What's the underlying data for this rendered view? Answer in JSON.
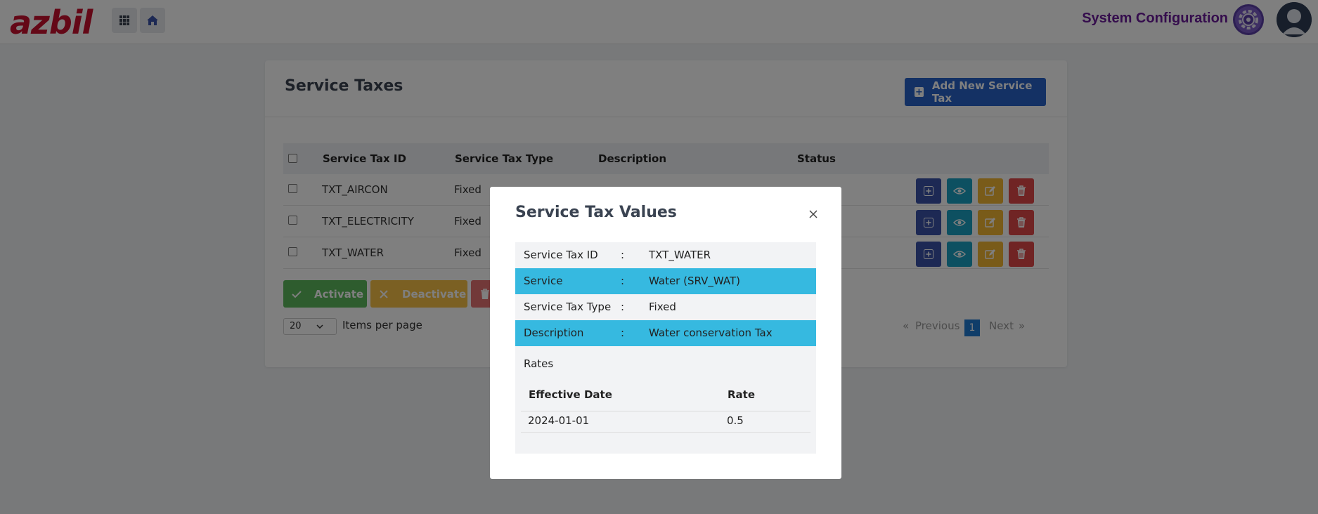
{
  "app": {
    "logo_text": "azbil",
    "section_title": "System Configuration",
    "icons": [
      "apps-grid-icon",
      "home-icon",
      "gear-icon",
      "user-avatar-icon"
    ]
  },
  "page": {
    "title": "Service Taxes",
    "add_button_label": "Add New Service Tax",
    "table": {
      "headers": [
        "Service Tax ID",
        "Service Tax Type",
        "Description",
        "Status"
      ],
      "rows": [
        {
          "id": "TXT_AIRCON",
          "type": "Fixed"
        },
        {
          "id": "TXT_ELECTRICITY",
          "type": "Fixed"
        },
        {
          "id": "TXT_WATER",
          "type": "Fixed"
        }
      ]
    },
    "bulk_actions": {
      "activate": "Activate",
      "deactivate": "Deactivate"
    },
    "pagination": {
      "per_page_value": "20",
      "per_page_label": "Items per page",
      "previous": "Previous",
      "current": "1",
      "next": "Next",
      "prev_glyph": "«",
      "next_glyph": "»"
    }
  },
  "modal": {
    "title": "Service Tax Values",
    "separator": ":",
    "fields": [
      {
        "label": "Service Tax ID",
        "value": "TXT_WATER"
      },
      {
        "label": "Service",
        "value": "Water (SRV_WAT)"
      },
      {
        "label": "Service Tax Type",
        "value": "Fixed"
      },
      {
        "label": "Description",
        "value": "Water conservation Tax"
      }
    ],
    "rates": {
      "label": "Rates",
      "headers": [
        "Effective Date",
        "Rate"
      ],
      "rows": [
        {
          "effective_date": "2024-01-01",
          "rate": "0.5"
        }
      ]
    }
  },
  "colors": {
    "brand_red": "#c8102e",
    "primary_blue": "#2962c9",
    "highlight_cyan": "#36b9e0",
    "system_purple": "#6a1b9a"
  }
}
